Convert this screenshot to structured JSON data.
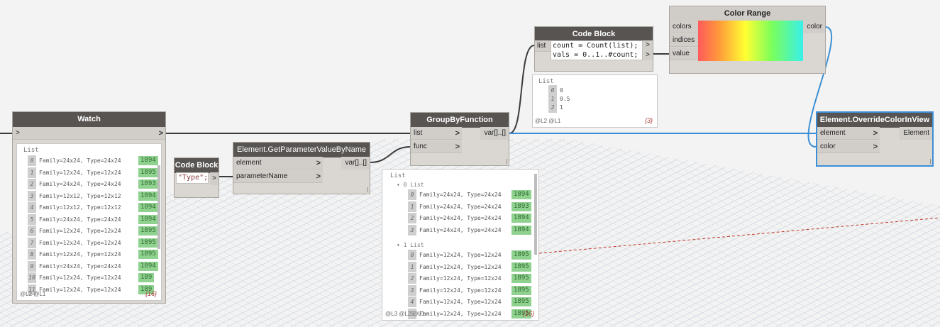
{
  "colors": {
    "wire": "#3b3b3b",
    "selected_wire": "#3c8fd6",
    "node_title_bg": "#575452",
    "value_bg": "#8fd18f"
  },
  "watch": {
    "title": "Watch",
    "in_arrow": ">",
    "out_arrow": ">",
    "list_label": "List",
    "rows": [
      {
        "i": "0",
        "text": "Family=24x24, Type=24x24",
        "val": "1894"
      },
      {
        "i": "1",
        "text": "Family=12x24, Type=12x24",
        "val": "1895"
      },
      {
        "i": "2",
        "text": "Family=24x24, Type=24x24",
        "val": "1893"
      },
      {
        "i": "3",
        "text": "Family=12x12, Type=12x12",
        "val": "1894"
      },
      {
        "i": "4",
        "text": "Family=12x12, Type=12x12",
        "val": "1894"
      },
      {
        "i": "5",
        "text": "Family=24x24, Type=24x24",
        "val": "1894"
      },
      {
        "i": "6",
        "text": "Family=12x24, Type=12x24",
        "val": "1895"
      },
      {
        "i": "7",
        "text": "Family=12x24, Type=12x24",
        "val": "1895"
      },
      {
        "i": "8",
        "text": "Family=12x24, Type=12x24",
        "val": "1895"
      },
      {
        "i": "9",
        "text": "Family=24x24, Type=24x24",
        "val": "1894"
      },
      {
        "i": "10",
        "text": "Family=12x24, Type=12x24",
        "val": "189"
      },
      {
        "i": "11",
        "text": "Family=12x24, Type=12x24",
        "val": "189"
      }
    ],
    "levels": "@L2 @L1",
    "count": "{16}"
  },
  "code_block_type": {
    "title": "Code Block",
    "code": "\"Type\";",
    "out": ">"
  },
  "get_param": {
    "title": "Element.GetParameterValueByName",
    "inputs": [
      "element",
      "parameterName"
    ],
    "output": "var[]..[]"
  },
  "group_by": {
    "title": "GroupByFunction",
    "inputs": [
      "list",
      "func"
    ],
    "output": "var[]..[]",
    "preview": {
      "list_label": "List",
      "groups": [
        {
          "label": "0 List",
          "rows": [
            {
              "i": "0",
              "text": "Family=24x24, Type=24x24",
              "val": "1894"
            },
            {
              "i": "1",
              "text": "Family=24x24, Type=24x24",
              "val": "1893"
            },
            {
              "i": "2",
              "text": "Family=24x24, Type=24x24",
              "val": "1894"
            },
            {
              "i": "3",
              "text": "Family=24x24, Type=24x24",
              "val": "1894"
            }
          ]
        },
        {
          "label": "1 List",
          "rows": [
            {
              "i": "0",
              "text": "Family=12x24, Type=12x24",
              "val": "1895"
            },
            {
              "i": "1",
              "text": "Family=12x24, Type=12x24",
              "val": "1895"
            },
            {
              "i": "2",
              "text": "Family=12x24, Type=12x24",
              "val": "1895"
            },
            {
              "i": "3",
              "text": "Family=12x24, Type=12x24",
              "val": "1895"
            },
            {
              "i": "4",
              "text": "Family=12x24, Type=12x24",
              "val": "1895"
            },
            {
              "i": "5",
              "text": "Family=12x24, Type=12x24",
              "val": "1895"
            }
          ]
        }
      ],
      "levels": "@L3 @L2 @L1",
      "count": "{16}"
    }
  },
  "code_block_count": {
    "title": "Code Block",
    "input": "list",
    "line1": "count = Count(list);",
    "line2": "vals = 0..1..#count;",
    "out1": ">",
    "out2": ">",
    "preview": {
      "list_label": "List",
      "rows": [
        {
          "i": "0",
          "v": "0"
        },
        {
          "i": "1",
          "v": "0.5"
        },
        {
          "i": "2",
          "v": "1"
        }
      ],
      "levels": "@L2 @L1",
      "count": "{3}"
    }
  },
  "color_range": {
    "title": "Color Range",
    "inputs": [
      "colors",
      "indices",
      "value"
    ],
    "output": "color"
  },
  "override": {
    "title": "Element.OverrideColorInView",
    "inputs": [
      "element",
      "color"
    ],
    "output": "Element"
  }
}
